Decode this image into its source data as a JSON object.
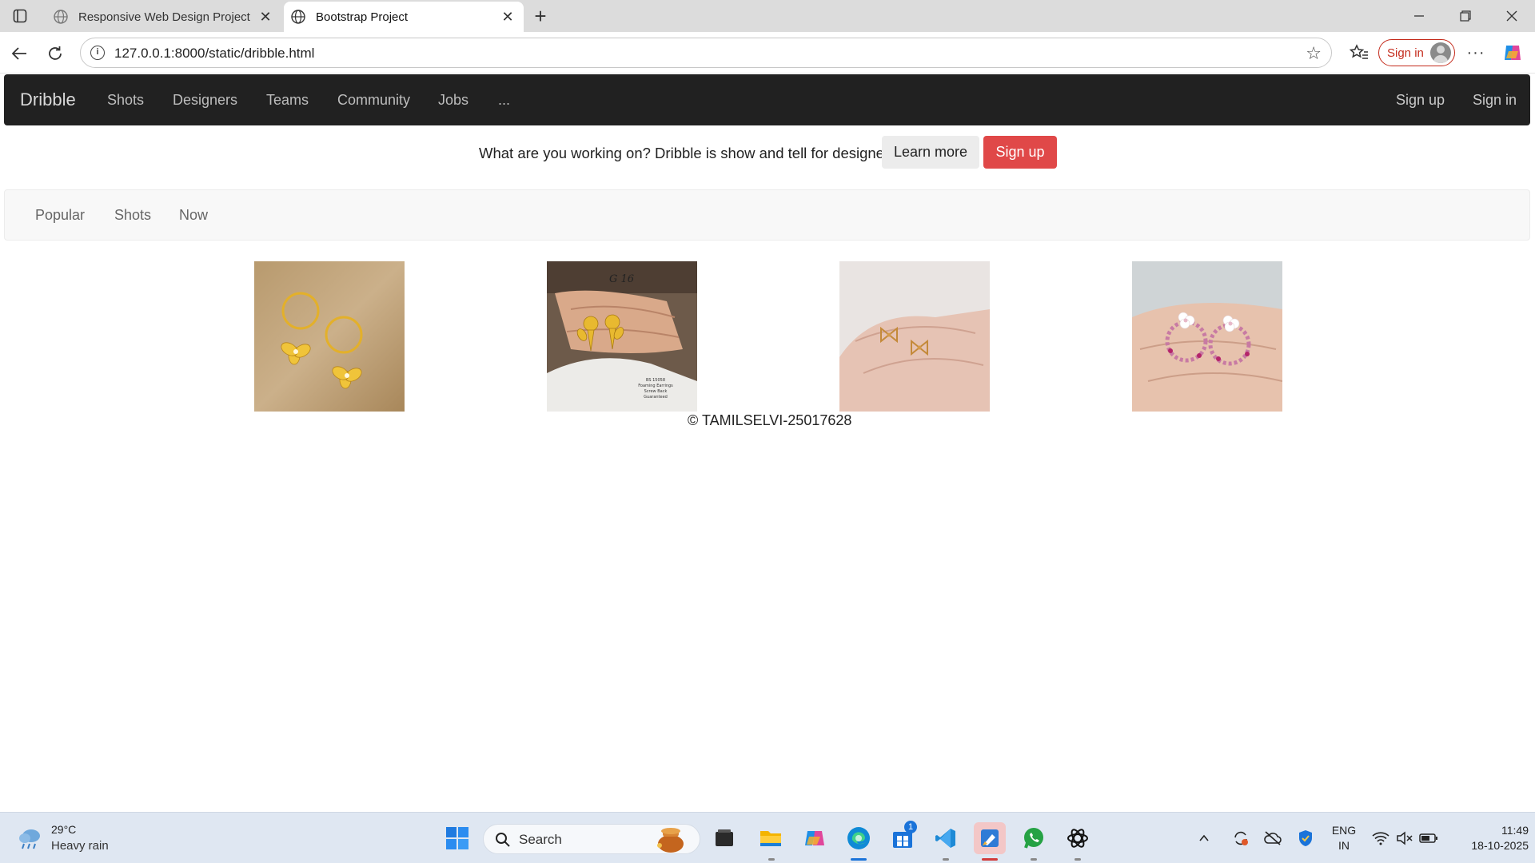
{
  "browser": {
    "tabs": [
      {
        "title": "Responsive Web Design Project"
      },
      {
        "title": "Bootstrap Project"
      }
    ],
    "url": "127.0.0.1:8000/static/dribble.html",
    "signin_label": "Sign in"
  },
  "site": {
    "brand": "Dribble",
    "nav_links": [
      "Shots",
      "Designers",
      "Teams",
      "Community",
      "Jobs",
      "..."
    ],
    "nav_right": [
      "Sign up",
      "Sign in"
    ],
    "promo_text": "What are you working on? Dribble is show and tell for designers.",
    "learn_more_label": "Learn more",
    "signup_label": "Sign up",
    "sub_nav": [
      "Popular",
      "Shots",
      "Now"
    ],
    "shot_captions": [
      "G 16",
      "BS 15058",
      "Foaming Earrings",
      "Screw Back",
      "Guaranteed"
    ],
    "footer": "© TAMILSELVI-25017628"
  },
  "taskbar": {
    "weather_temp": "29°C",
    "weather_desc": "Heavy rain",
    "search_label": "Search",
    "store_badge": "1",
    "lang_primary": "ENG",
    "lang_secondary": "IN",
    "time": "11:49",
    "date": "18-10-2025"
  },
  "colors": {
    "navbar_bg": "#212121",
    "signup_button": "#e04848",
    "signin_pill": "#c42b1c",
    "taskbar_bg": "#dfe7f2"
  }
}
